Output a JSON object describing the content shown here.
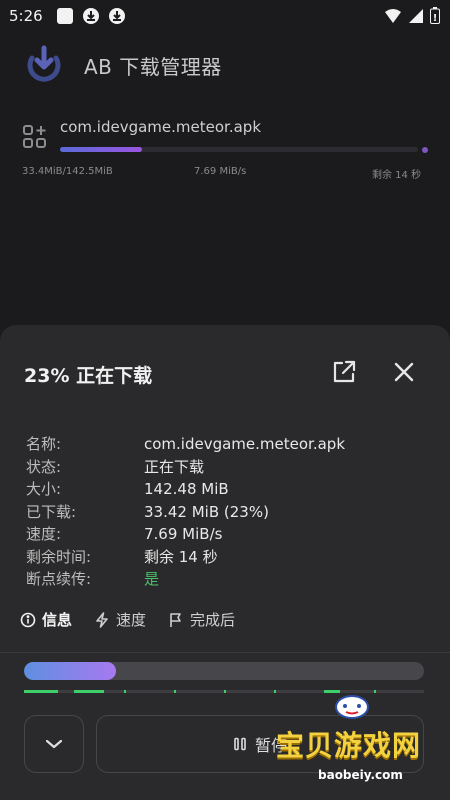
{
  "status_bar": {
    "time": "5:26"
  },
  "app": {
    "title": "AB 下载管理器"
  },
  "download_item": {
    "file_name": "com.idevgame.meteor.apk",
    "size_progress": "33.4MiB/142.5MiB",
    "speed": "7.69 MiB/s",
    "remaining": "剩余 14 秒",
    "progress": 0.23
  },
  "sheet": {
    "title": "23% 正在下载",
    "info": [
      {
        "label": "名称:",
        "value": "com.idevgame.meteor.apk"
      },
      {
        "label": "状态:",
        "value": "正在下载"
      },
      {
        "label": "大小:",
        "value": "142.48 MiB"
      },
      {
        "label": "已下载:",
        "value": "33.42 MiB (23%)"
      },
      {
        "label": "速度:",
        "value": "7.69 MiB/s"
      },
      {
        "label": "剩余时间:",
        "value": "剩余 14 秒"
      },
      {
        "label": "断点续传:",
        "value": "是"
      }
    ],
    "tabs": [
      {
        "label": "信息"
      },
      {
        "label": "速度"
      },
      {
        "label": "完成后"
      }
    ],
    "pause_label": "暂停",
    "progress": 0.23
  },
  "watermark": {
    "text": "宝贝游戏网",
    "subtext": "baobeiy.com"
  },
  "colors": {
    "accent_start": "#5e8fe0",
    "accent_end": "#a879f0",
    "segment": "#3ccf6a",
    "ok": "#4cbf6a"
  }
}
